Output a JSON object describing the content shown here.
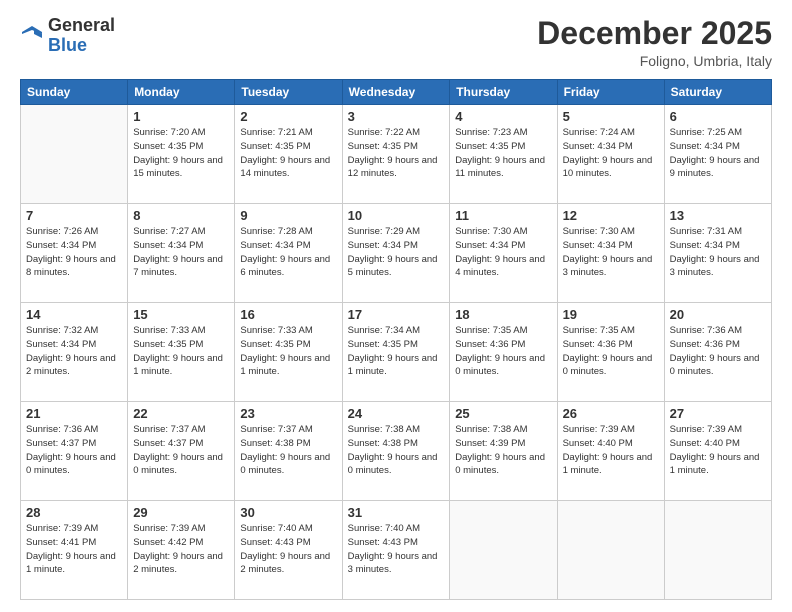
{
  "header": {
    "logo_general": "General",
    "logo_blue": "Blue",
    "month_title": "December 2025",
    "location": "Foligno, Umbria, Italy"
  },
  "columns": [
    "Sunday",
    "Monday",
    "Tuesday",
    "Wednesday",
    "Thursday",
    "Friday",
    "Saturday"
  ],
  "weeks": [
    [
      {
        "day": "",
        "sunrise": "",
        "sunset": "",
        "daylight": ""
      },
      {
        "day": "1",
        "sunrise": "Sunrise: 7:20 AM",
        "sunset": "Sunset: 4:35 PM",
        "daylight": "Daylight: 9 hours and 15 minutes."
      },
      {
        "day": "2",
        "sunrise": "Sunrise: 7:21 AM",
        "sunset": "Sunset: 4:35 PM",
        "daylight": "Daylight: 9 hours and 14 minutes."
      },
      {
        "day": "3",
        "sunrise": "Sunrise: 7:22 AM",
        "sunset": "Sunset: 4:35 PM",
        "daylight": "Daylight: 9 hours and 12 minutes."
      },
      {
        "day": "4",
        "sunrise": "Sunrise: 7:23 AM",
        "sunset": "Sunset: 4:35 PM",
        "daylight": "Daylight: 9 hours and 11 minutes."
      },
      {
        "day": "5",
        "sunrise": "Sunrise: 7:24 AM",
        "sunset": "Sunset: 4:34 PM",
        "daylight": "Daylight: 9 hours and 10 minutes."
      },
      {
        "day": "6",
        "sunrise": "Sunrise: 7:25 AM",
        "sunset": "Sunset: 4:34 PM",
        "daylight": "Daylight: 9 hours and 9 minutes."
      }
    ],
    [
      {
        "day": "7",
        "sunrise": "Sunrise: 7:26 AM",
        "sunset": "Sunset: 4:34 PM",
        "daylight": "Daylight: 9 hours and 8 minutes."
      },
      {
        "day": "8",
        "sunrise": "Sunrise: 7:27 AM",
        "sunset": "Sunset: 4:34 PM",
        "daylight": "Daylight: 9 hours and 7 minutes."
      },
      {
        "day": "9",
        "sunrise": "Sunrise: 7:28 AM",
        "sunset": "Sunset: 4:34 PM",
        "daylight": "Daylight: 9 hours and 6 minutes."
      },
      {
        "day": "10",
        "sunrise": "Sunrise: 7:29 AM",
        "sunset": "Sunset: 4:34 PM",
        "daylight": "Daylight: 9 hours and 5 minutes."
      },
      {
        "day": "11",
        "sunrise": "Sunrise: 7:30 AM",
        "sunset": "Sunset: 4:34 PM",
        "daylight": "Daylight: 9 hours and 4 minutes."
      },
      {
        "day": "12",
        "sunrise": "Sunrise: 7:30 AM",
        "sunset": "Sunset: 4:34 PM",
        "daylight": "Daylight: 9 hours and 3 minutes."
      },
      {
        "day": "13",
        "sunrise": "Sunrise: 7:31 AM",
        "sunset": "Sunset: 4:34 PM",
        "daylight": "Daylight: 9 hours and 3 minutes."
      }
    ],
    [
      {
        "day": "14",
        "sunrise": "Sunrise: 7:32 AM",
        "sunset": "Sunset: 4:34 PM",
        "daylight": "Daylight: 9 hours and 2 minutes."
      },
      {
        "day": "15",
        "sunrise": "Sunrise: 7:33 AM",
        "sunset": "Sunset: 4:35 PM",
        "daylight": "Daylight: 9 hours and 1 minute."
      },
      {
        "day": "16",
        "sunrise": "Sunrise: 7:33 AM",
        "sunset": "Sunset: 4:35 PM",
        "daylight": "Daylight: 9 hours and 1 minute."
      },
      {
        "day": "17",
        "sunrise": "Sunrise: 7:34 AM",
        "sunset": "Sunset: 4:35 PM",
        "daylight": "Daylight: 9 hours and 1 minute."
      },
      {
        "day": "18",
        "sunrise": "Sunrise: 7:35 AM",
        "sunset": "Sunset: 4:36 PM",
        "daylight": "Daylight: 9 hours and 0 minutes."
      },
      {
        "day": "19",
        "sunrise": "Sunrise: 7:35 AM",
        "sunset": "Sunset: 4:36 PM",
        "daylight": "Daylight: 9 hours and 0 minutes."
      },
      {
        "day": "20",
        "sunrise": "Sunrise: 7:36 AM",
        "sunset": "Sunset: 4:36 PM",
        "daylight": "Daylight: 9 hours and 0 minutes."
      }
    ],
    [
      {
        "day": "21",
        "sunrise": "Sunrise: 7:36 AM",
        "sunset": "Sunset: 4:37 PM",
        "daylight": "Daylight: 9 hours and 0 minutes."
      },
      {
        "day": "22",
        "sunrise": "Sunrise: 7:37 AM",
        "sunset": "Sunset: 4:37 PM",
        "daylight": "Daylight: 9 hours and 0 minutes."
      },
      {
        "day": "23",
        "sunrise": "Sunrise: 7:37 AM",
        "sunset": "Sunset: 4:38 PM",
        "daylight": "Daylight: 9 hours and 0 minutes."
      },
      {
        "day": "24",
        "sunrise": "Sunrise: 7:38 AM",
        "sunset": "Sunset: 4:38 PM",
        "daylight": "Daylight: 9 hours and 0 minutes."
      },
      {
        "day": "25",
        "sunrise": "Sunrise: 7:38 AM",
        "sunset": "Sunset: 4:39 PM",
        "daylight": "Daylight: 9 hours and 0 minutes."
      },
      {
        "day": "26",
        "sunrise": "Sunrise: 7:39 AM",
        "sunset": "Sunset: 4:40 PM",
        "daylight": "Daylight: 9 hours and 1 minute."
      },
      {
        "day": "27",
        "sunrise": "Sunrise: 7:39 AM",
        "sunset": "Sunset: 4:40 PM",
        "daylight": "Daylight: 9 hours and 1 minute."
      }
    ],
    [
      {
        "day": "28",
        "sunrise": "Sunrise: 7:39 AM",
        "sunset": "Sunset: 4:41 PM",
        "daylight": "Daylight: 9 hours and 1 minute."
      },
      {
        "day": "29",
        "sunrise": "Sunrise: 7:39 AM",
        "sunset": "Sunset: 4:42 PM",
        "daylight": "Daylight: 9 hours and 2 minutes."
      },
      {
        "day": "30",
        "sunrise": "Sunrise: 7:40 AM",
        "sunset": "Sunset: 4:43 PM",
        "daylight": "Daylight: 9 hours and 2 minutes."
      },
      {
        "day": "31",
        "sunrise": "Sunrise: 7:40 AM",
        "sunset": "Sunset: 4:43 PM",
        "daylight": "Daylight: 9 hours and 3 minutes."
      },
      {
        "day": "",
        "sunrise": "",
        "sunset": "",
        "daylight": ""
      },
      {
        "day": "",
        "sunrise": "",
        "sunset": "",
        "daylight": ""
      },
      {
        "day": "",
        "sunrise": "",
        "sunset": "",
        "daylight": ""
      }
    ]
  ]
}
